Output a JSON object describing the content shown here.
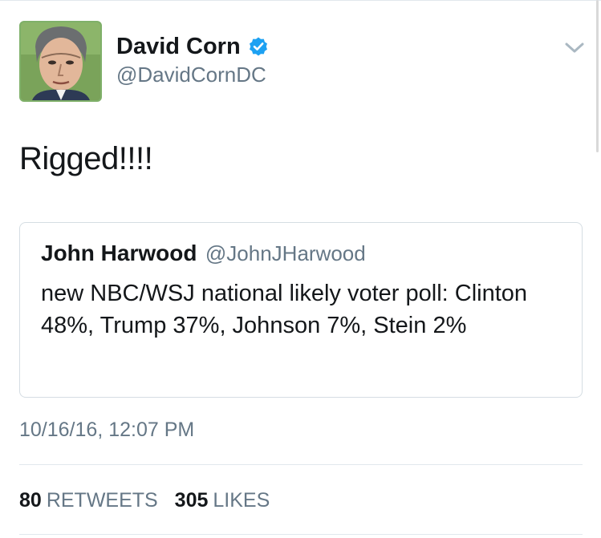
{
  "author": {
    "name": "David Corn",
    "handle": "@DavidCornDC",
    "verified": true,
    "avatar_icon": "avatar-portrait"
  },
  "tweet": {
    "text": "Rigged!!!!",
    "timestamp": "10/16/16, 12:07 PM"
  },
  "quoted_tweet": {
    "name": "John Harwood",
    "handle": "@JohnJHarwood",
    "text": "new NBC/WSJ national likely voter poll: Clinton 48%, Trump 37%, Johnson 7%, Stein 2%"
  },
  "stats": {
    "retweets_count": "80",
    "retweets_label": "RETWEETS",
    "likes_count": "305",
    "likes_label": "LIKES"
  },
  "icons": {
    "verified": "verified-badge-icon",
    "menu": "chevron-down-icon"
  },
  "colors": {
    "text_primary": "#14171a",
    "text_secondary": "#657786",
    "verified_blue": "#1da1f2",
    "divider": "#e1e8ed"
  }
}
